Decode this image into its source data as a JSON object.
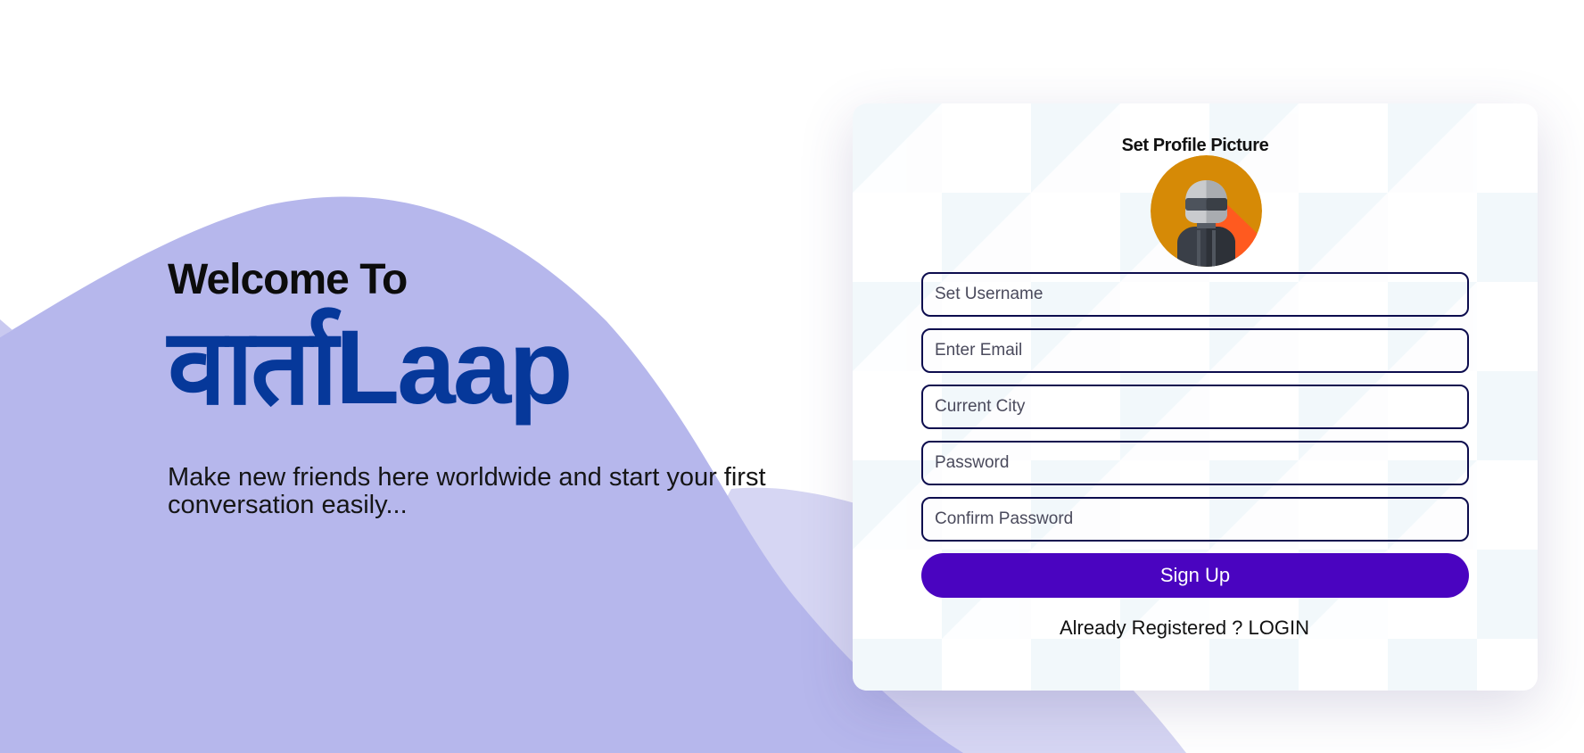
{
  "hero": {
    "welcome": "Welcome To",
    "brand": "वार्ताLaap",
    "tagline": "Make new friends here worldwide and start your first conversation easily..."
  },
  "signup_card": {
    "profile_title": "Set Profile Picture",
    "avatar_icon": "user-avatar-icon",
    "fields": {
      "username_placeholder": "Set Username",
      "email_placeholder": "Enter Email",
      "city_placeholder": "Current City",
      "password_placeholder": "Password",
      "confirm_password_placeholder": "Confirm Password"
    },
    "signup_label": "Sign Up",
    "already_registered": "Already Registered ?",
    "login_label": "LOGIN"
  },
  "colors": {
    "brand": "#06389a",
    "accent_button": "#4a04c0",
    "wave": "#b6b7ec",
    "field_border": "#0d0d4e"
  }
}
